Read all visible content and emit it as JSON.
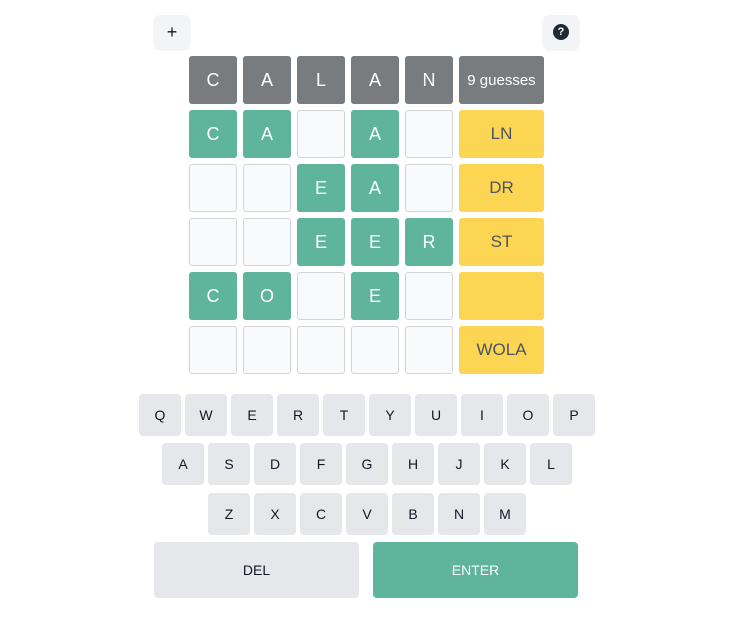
{
  "header": {
    "plus_label": "+",
    "help_label": "?"
  },
  "colors": {
    "correct": "#5fb49c",
    "revealed": "#787c7e",
    "hint": "#fcd553",
    "key": "#e5e7eb",
    "empty": "#f9fafb"
  },
  "board": [
    {
      "letters": [
        "C",
        "A",
        "L",
        "A",
        "N"
      ],
      "states": [
        "gray",
        "gray",
        "gray",
        "gray",
        "gray"
      ],
      "hint": "9 guesses",
      "hint_state": "gray"
    },
    {
      "letters": [
        "C",
        "A",
        "",
        "A",
        ""
      ],
      "states": [
        "green",
        "green",
        "empty",
        "green",
        "empty"
      ],
      "hint": "LN",
      "hint_state": "yellow"
    },
    {
      "letters": [
        "",
        "",
        "E",
        "A",
        ""
      ],
      "states": [
        "empty",
        "empty",
        "green",
        "green",
        "empty"
      ],
      "hint": "DR",
      "hint_state": "yellow"
    },
    {
      "letters": [
        "",
        "",
        "E",
        "E",
        "R"
      ],
      "states": [
        "empty",
        "empty",
        "green",
        "green",
        "green"
      ],
      "hint": "ST",
      "hint_state": "yellow"
    },
    {
      "letters": [
        "C",
        "O",
        "",
        "E",
        ""
      ],
      "states": [
        "green",
        "green",
        "empty",
        "green",
        "empty"
      ],
      "hint": "",
      "hint_state": "yellow"
    },
    {
      "letters": [
        "",
        "",
        "",
        "",
        ""
      ],
      "states": [
        "empty",
        "empty",
        "empty",
        "empty",
        "empty"
      ],
      "hint": "WOLA",
      "hint_state": "yellow"
    }
  ],
  "keyboard": {
    "rows": [
      [
        "Q",
        "W",
        "E",
        "R",
        "T",
        "Y",
        "U",
        "I",
        "O",
        "P"
      ],
      [
        "A",
        "S",
        "D",
        "F",
        "G",
        "H",
        "J",
        "K",
        "L"
      ],
      [
        "Z",
        "X",
        "C",
        "V",
        "B",
        "N",
        "M"
      ]
    ],
    "del_label": "DEL",
    "enter_label": "ENTER"
  }
}
